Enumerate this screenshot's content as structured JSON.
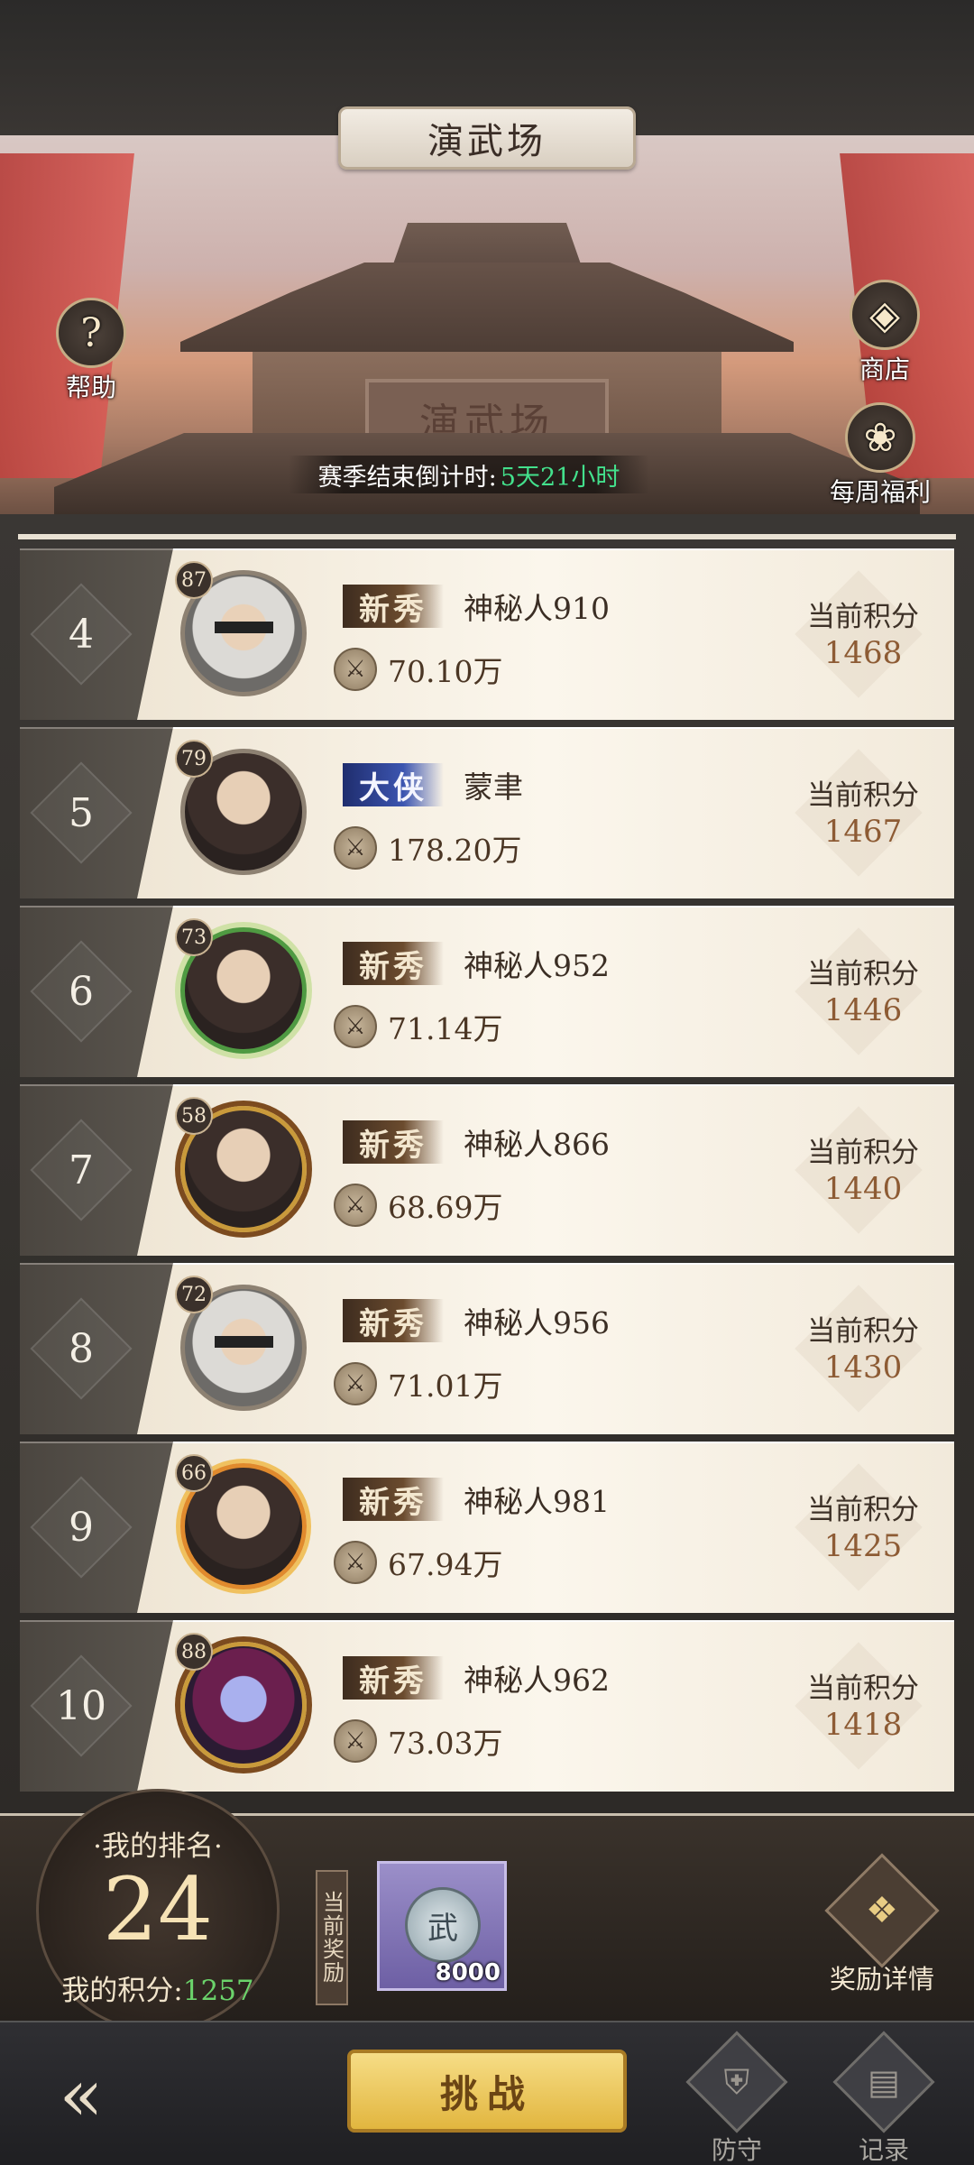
{
  "header": {
    "title": "演武场",
    "plaque_text": "演武场",
    "help_label": "帮助",
    "shop_label": "商店",
    "weekly_label": "每周福利",
    "countdown_label": "赛季结束倒计时:",
    "countdown_value": "5天21小时"
  },
  "rows": [
    {
      "rank": "4",
      "level": "87",
      "title": "新秀",
      "name": "神秘人910",
      "power": "70.10万",
      "score_label": "当前积分",
      "score": "1468"
    },
    {
      "rank": "5",
      "level": "79",
      "title": "大侠",
      "name": "蒙聿",
      "power": "178.20万",
      "score_label": "当前积分",
      "score": "1467"
    },
    {
      "rank": "6",
      "level": "73",
      "title": "新秀",
      "name": "神秘人952",
      "power": "71.14万",
      "score_label": "当前积分",
      "score": "1446"
    },
    {
      "rank": "7",
      "level": "58",
      "title": "新秀",
      "name": "神秘人866",
      "power": "68.69万",
      "score_label": "当前积分",
      "score": "1440"
    },
    {
      "rank": "8",
      "level": "72",
      "title": "新秀",
      "name": "神秘人956",
      "power": "71.01万",
      "score_label": "当前积分",
      "score": "1430"
    },
    {
      "rank": "9",
      "level": "66",
      "title": "新秀",
      "name": "神秘人981",
      "power": "67.94万",
      "score_label": "当前积分",
      "score": "1425"
    },
    {
      "rank": "10",
      "level": "88",
      "title": "新秀",
      "name": "神秘人962",
      "power": "73.03万",
      "score_label": "当前积分",
      "score": "1418"
    }
  ],
  "my_rank": {
    "label": "·我的排名·",
    "value": "24",
    "score_label": "我的积分:",
    "score_value": "1257"
  },
  "reward": {
    "tag": "当前奖励",
    "coin_char": "武",
    "quantity": "8000",
    "detail_label": "奖励详情"
  },
  "nav": {
    "challenge_label": "挑战",
    "defend_label": "防守",
    "record_label": "记录"
  },
  "colors": {
    "accent_gold": "#e2b63f",
    "countdown_green": "#43e08c",
    "score_green": "#6bd36b"
  }
}
